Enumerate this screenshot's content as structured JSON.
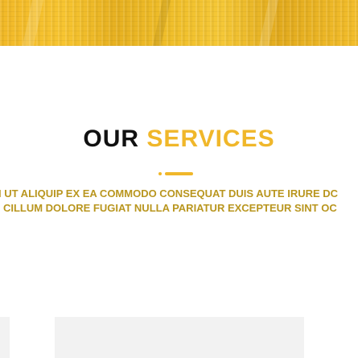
{
  "hero": {
    "description": ""
  },
  "section": {
    "title_part1": "OUR",
    "title_part2": "SERVICES",
    "accent_color": "#f0b72a",
    "body_lines": [
      "I UT ALIQUIP EX EA COMMODO CONSEQUAT DUIS AUTE IRURE DC",
      "ES CILLUM DOLORE FUGIAT NULLA PARIATUR EXCEPTEUR SINT OC"
    ]
  },
  "cards": {
    "count_visible": 2
  }
}
